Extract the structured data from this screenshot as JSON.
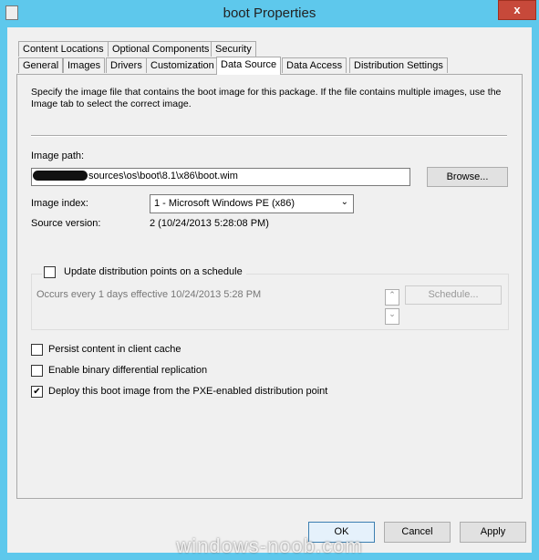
{
  "window": {
    "title": "boot Properties",
    "close": "x"
  },
  "tabs_row1": [
    "Content Locations",
    "Optional Components",
    "Security"
  ],
  "tabs_row2": [
    "General",
    "Images",
    "Drivers",
    "Customization",
    "Data Source",
    "Data Access",
    "Distribution Settings"
  ],
  "active_tab": "Data Source",
  "description": "Specify the image file that contains the boot image for this package. If the file contains multiple images, use the Image tab to select the correct image.",
  "image_path": {
    "label": "Image path:",
    "value": "sources\\os\\boot\\8.1\\x86\\boot.wim",
    "browse": "Browse..."
  },
  "image_index": {
    "label": "Image index:",
    "value": "1 - Microsoft Windows PE (x86)"
  },
  "source_version": {
    "label": "Source version:",
    "value": "2 (10/24/2013 5:28:08 PM)"
  },
  "schedule": {
    "label": "Update distribution points on a schedule",
    "checked": false,
    "text": "Occurs every 1 days effective 10/24/2013 5:28 PM",
    "button": "Schedule..."
  },
  "options": [
    {
      "label": "Persist content in client cache",
      "checked": false
    },
    {
      "label": "Enable binary differential replication",
      "checked": false
    },
    {
      "label": "Deploy this boot image from the PXE-enabled distribution point",
      "checked": true
    }
  ],
  "buttons": {
    "ok": "OK",
    "cancel": "Cancel",
    "apply": "Apply"
  },
  "watermark": "windows-noob.com"
}
